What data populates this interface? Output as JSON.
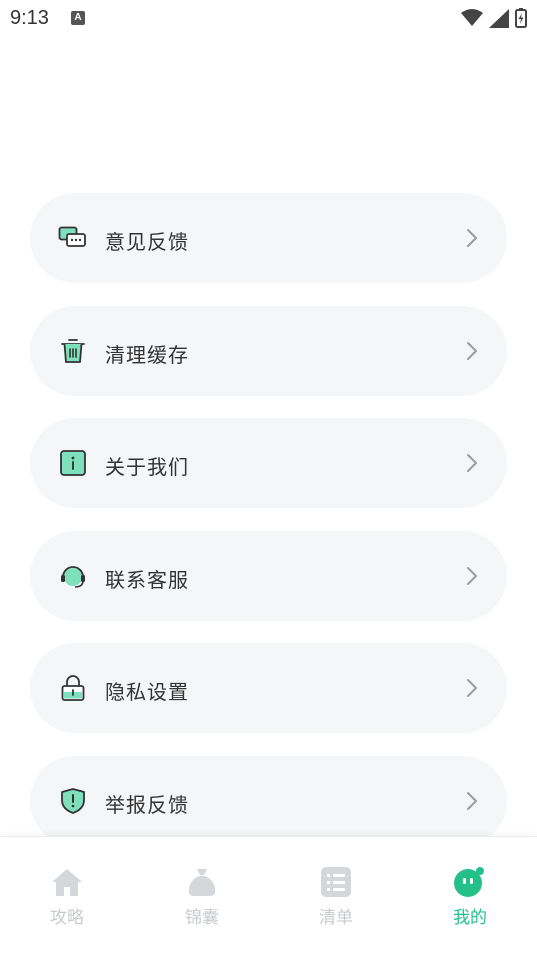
{
  "status_bar": {
    "time": "9:13",
    "notification_letter": "A"
  },
  "menu": {
    "items": [
      {
        "label": "意见反馈",
        "icon": "feedback-chat-icon"
      },
      {
        "label": "清理缓存",
        "icon": "trash-icon"
      },
      {
        "label": "关于我们",
        "icon": "info-icon"
      },
      {
        "label": "联系客服",
        "icon": "headset-icon"
      },
      {
        "label": "隐私设置",
        "icon": "lock-icon"
      },
      {
        "label": "举报反馈",
        "icon": "shield-alert-icon"
      }
    ]
  },
  "bottom_nav": {
    "items": [
      {
        "label": "攻略",
        "icon": "home-icon",
        "active": false
      },
      {
        "label": "锦囊",
        "icon": "bag-icon",
        "active": false
      },
      {
        "label": "清单",
        "icon": "list-icon",
        "active": false
      },
      {
        "label": "我的",
        "icon": "profile-face-icon",
        "active": true
      }
    ]
  },
  "colors": {
    "accent": "#23c08a",
    "accent_light": "#7fe0bd",
    "card_bg": "#f5f6f7",
    "inactive": "#c8cbce"
  }
}
